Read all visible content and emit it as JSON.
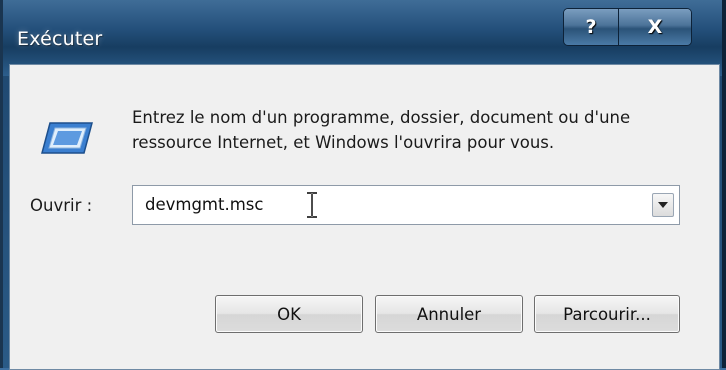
{
  "window": {
    "title": "Exécuter",
    "help_label": "?",
    "close_label": "X"
  },
  "dialog": {
    "description": "Entrez le nom d'un programme, dossier, document ou d'une ressource Internet, et Windows l'ouvrira pour vous.",
    "open_label": "Ouvrir :",
    "open_value": "devmgmt.msc",
    "ok_label": "OK",
    "cancel_label": "Annuler",
    "browse_label": "Parcourir..."
  },
  "icons": {
    "app": "run-icon",
    "dropdown": "chevron-down-icon",
    "cursor": "ibeam-cursor-icon"
  },
  "colors": {
    "titlebar": "#24507b",
    "client_bg": "#f0f0f0",
    "title_text": "#ffffff"
  }
}
